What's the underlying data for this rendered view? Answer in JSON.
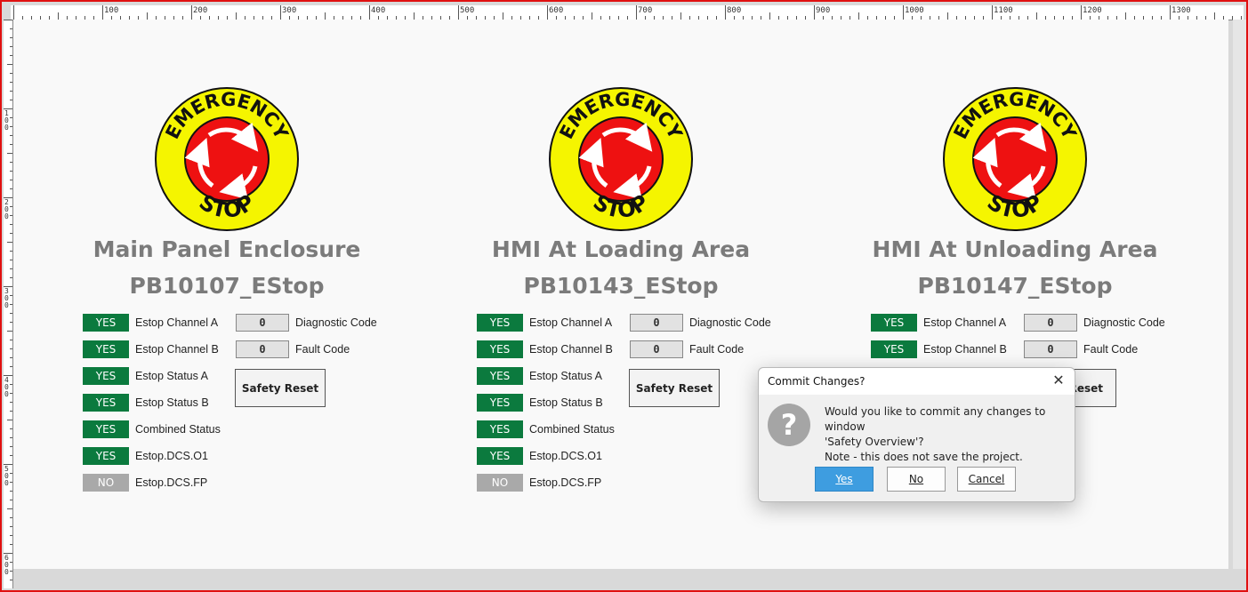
{
  "ruler": {
    "top_labels": [
      "100",
      "200",
      "300",
      "400",
      "500",
      "600",
      "700",
      "800",
      "900",
      "1000",
      "1100",
      "1200",
      "1300"
    ],
    "left_labels": [
      "100",
      "200",
      "300",
      "400",
      "500",
      "600"
    ]
  },
  "panels": [
    {
      "icon": "emergency-stop-icon",
      "title": "Main Panel Enclosure",
      "tag": "PB10107_EStop",
      "statuses": [
        {
          "value": "YES",
          "label": "Estop Channel A",
          "state": "on"
        },
        {
          "value": "YES",
          "label": "Estop Channel B",
          "state": "on"
        },
        {
          "value": "YES",
          "label": "Estop Status A",
          "state": "on"
        },
        {
          "value": "YES",
          "label": "Estop Status B",
          "state": "on"
        },
        {
          "value": "YES",
          "label": "Combined Status",
          "state": "on"
        },
        {
          "value": "YES",
          "label": "Estop.DCS.O1",
          "state": "on"
        },
        {
          "value": "NO",
          "label": "Estop.DCS.FP",
          "state": "off"
        }
      ],
      "codes": [
        {
          "value": "0",
          "label": "Diagnostic Code"
        },
        {
          "value": "0",
          "label": "Fault Code"
        }
      ],
      "reset_label": "Safety Reset"
    },
    {
      "icon": "emergency-stop-icon",
      "title": "HMI At Loading Area",
      "tag": "PB10143_EStop",
      "statuses": [
        {
          "value": "YES",
          "label": "Estop Channel A",
          "state": "on"
        },
        {
          "value": "YES",
          "label": "Estop Channel B",
          "state": "on"
        },
        {
          "value": "YES",
          "label": "Estop Status A",
          "state": "on"
        },
        {
          "value": "YES",
          "label": "Estop Status B",
          "state": "on"
        },
        {
          "value": "YES",
          "label": "Combined Status",
          "state": "on"
        },
        {
          "value": "YES",
          "label": "Estop.DCS.O1",
          "state": "on"
        },
        {
          "value": "NO",
          "label": "Estop.DCS.FP",
          "state": "off"
        }
      ],
      "codes": [
        {
          "value": "0",
          "label": "Diagnostic Code"
        },
        {
          "value": "0",
          "label": "Fault Code"
        }
      ],
      "reset_label": "Safety Reset"
    },
    {
      "icon": "emergency-stop-icon",
      "title": "HMI At Unloading Area",
      "tag": "PB10147_EStop",
      "statuses": [
        {
          "value": "YES",
          "label": "Estop Channel A",
          "state": "on"
        },
        {
          "value": "YES",
          "label": "Estop Channel B",
          "state": "on"
        }
      ],
      "codes": [
        {
          "value": "0",
          "label": "Diagnostic Code"
        },
        {
          "value": "0",
          "label": "Fault Code"
        }
      ],
      "reset_label": "Reset"
    }
  ],
  "estop_sign": {
    "top_text": "EMERGENCY",
    "bottom_text": "STOP",
    "ring_color": "#f5f500",
    "button_color": "#ee1111"
  },
  "dialog": {
    "title": "Commit Changes?",
    "message_lines": [
      "Would you like to commit any changes to window",
      "'Safety Overview'?",
      "Note - this does not save the project."
    ],
    "buttons": {
      "yes": "Yes",
      "no": "No",
      "cancel": "Cancel"
    },
    "close_icon": "close-icon",
    "question_icon": "question-icon",
    "question_glyph": "?"
  }
}
